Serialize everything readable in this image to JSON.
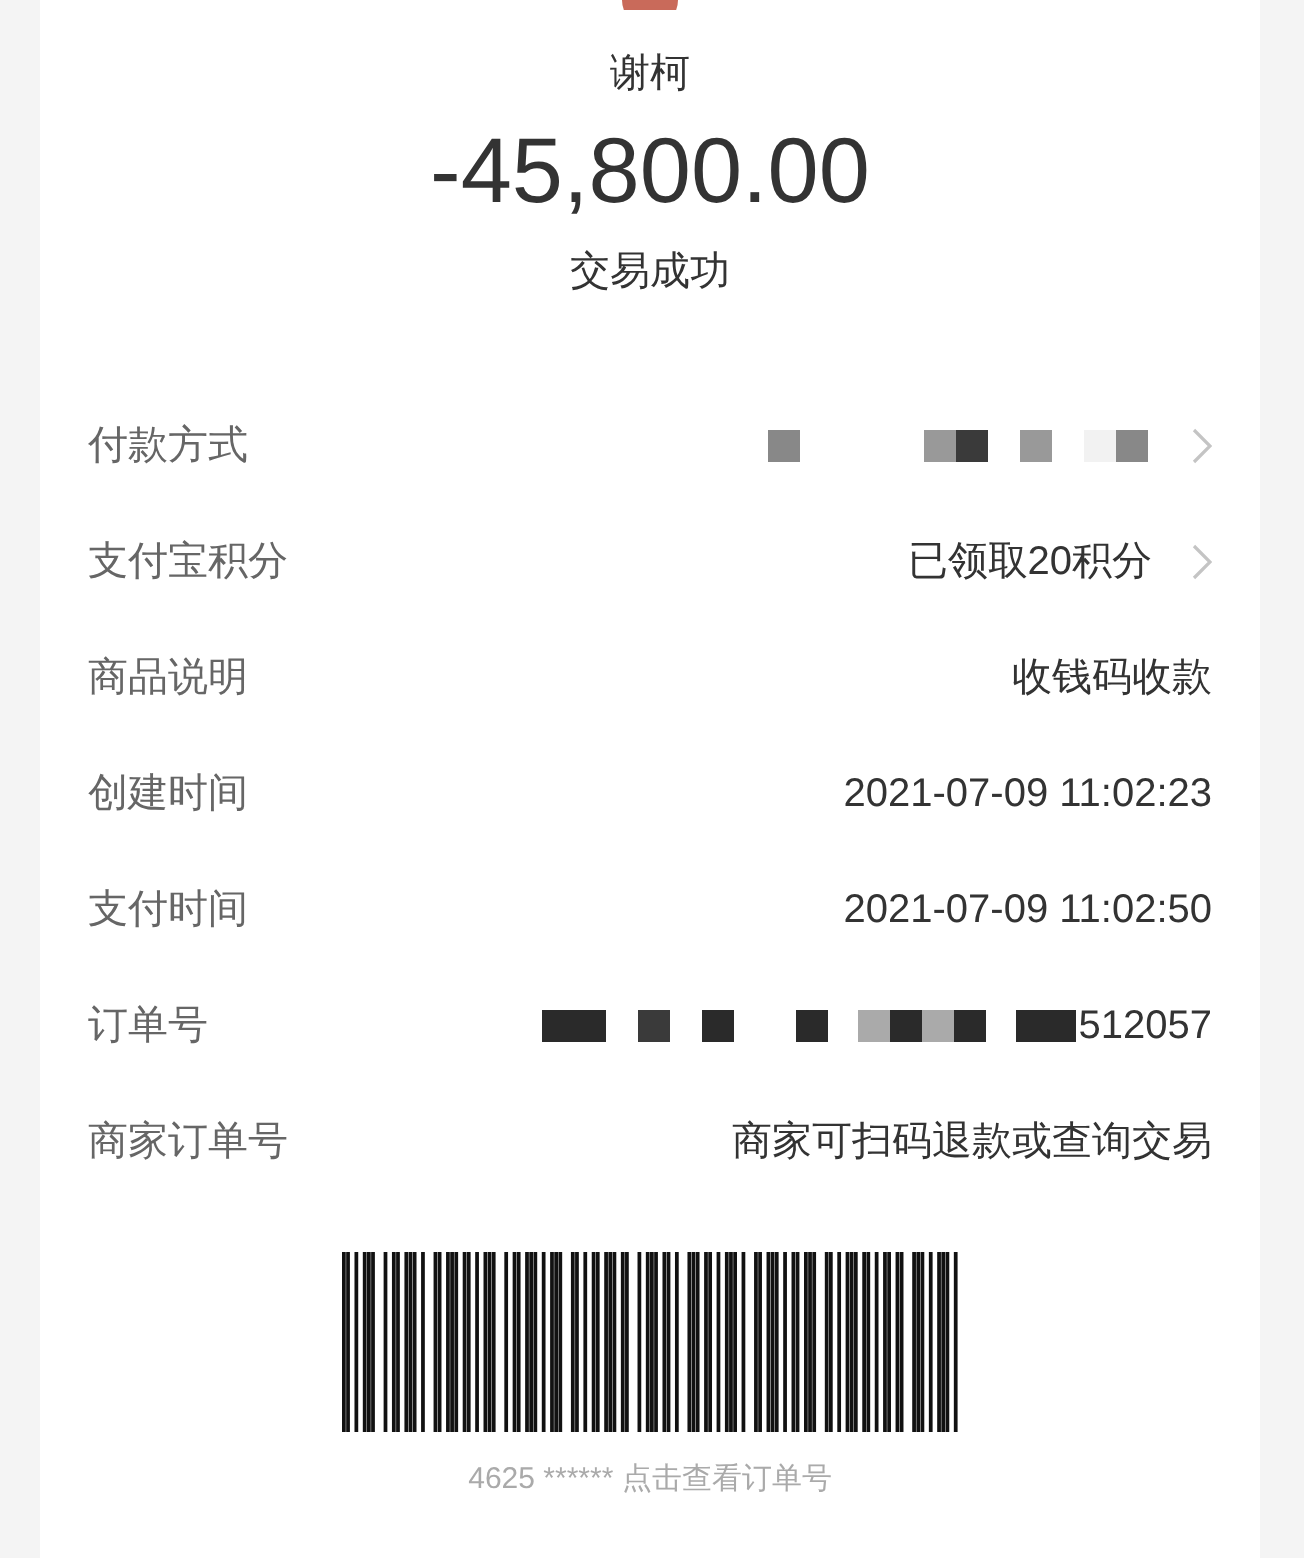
{
  "payee": {
    "name": "谢柯",
    "amount": "-45,800.00",
    "status": "交易成功"
  },
  "rows": [
    {
      "kind": "redacted",
      "label": "付款方式",
      "chevron": true
    },
    {
      "kind": "text",
      "label": "支付宝积分",
      "value": "已领取20积分",
      "chevron": true
    },
    {
      "kind": "text",
      "label": "商品说明",
      "value": "收钱码收款",
      "chevron": false
    },
    {
      "kind": "text",
      "label": "创建时间",
      "value": "2021-07-09 11:02:23",
      "chevron": false
    },
    {
      "kind": "text",
      "label": "支付时间",
      "value": "2021-07-09 11:02:50",
      "chevron": false
    },
    {
      "kind": "redacted",
      "label": "订单号",
      "value": "512057",
      "chevron": false
    },
    {
      "kind": "text",
      "label": "商家订单号",
      "value": "商家可扫码退款或查询交易",
      "chevron": false
    }
  ],
  "barcode": {
    "caption": "4625 ****** 点击查看订单号"
  }
}
